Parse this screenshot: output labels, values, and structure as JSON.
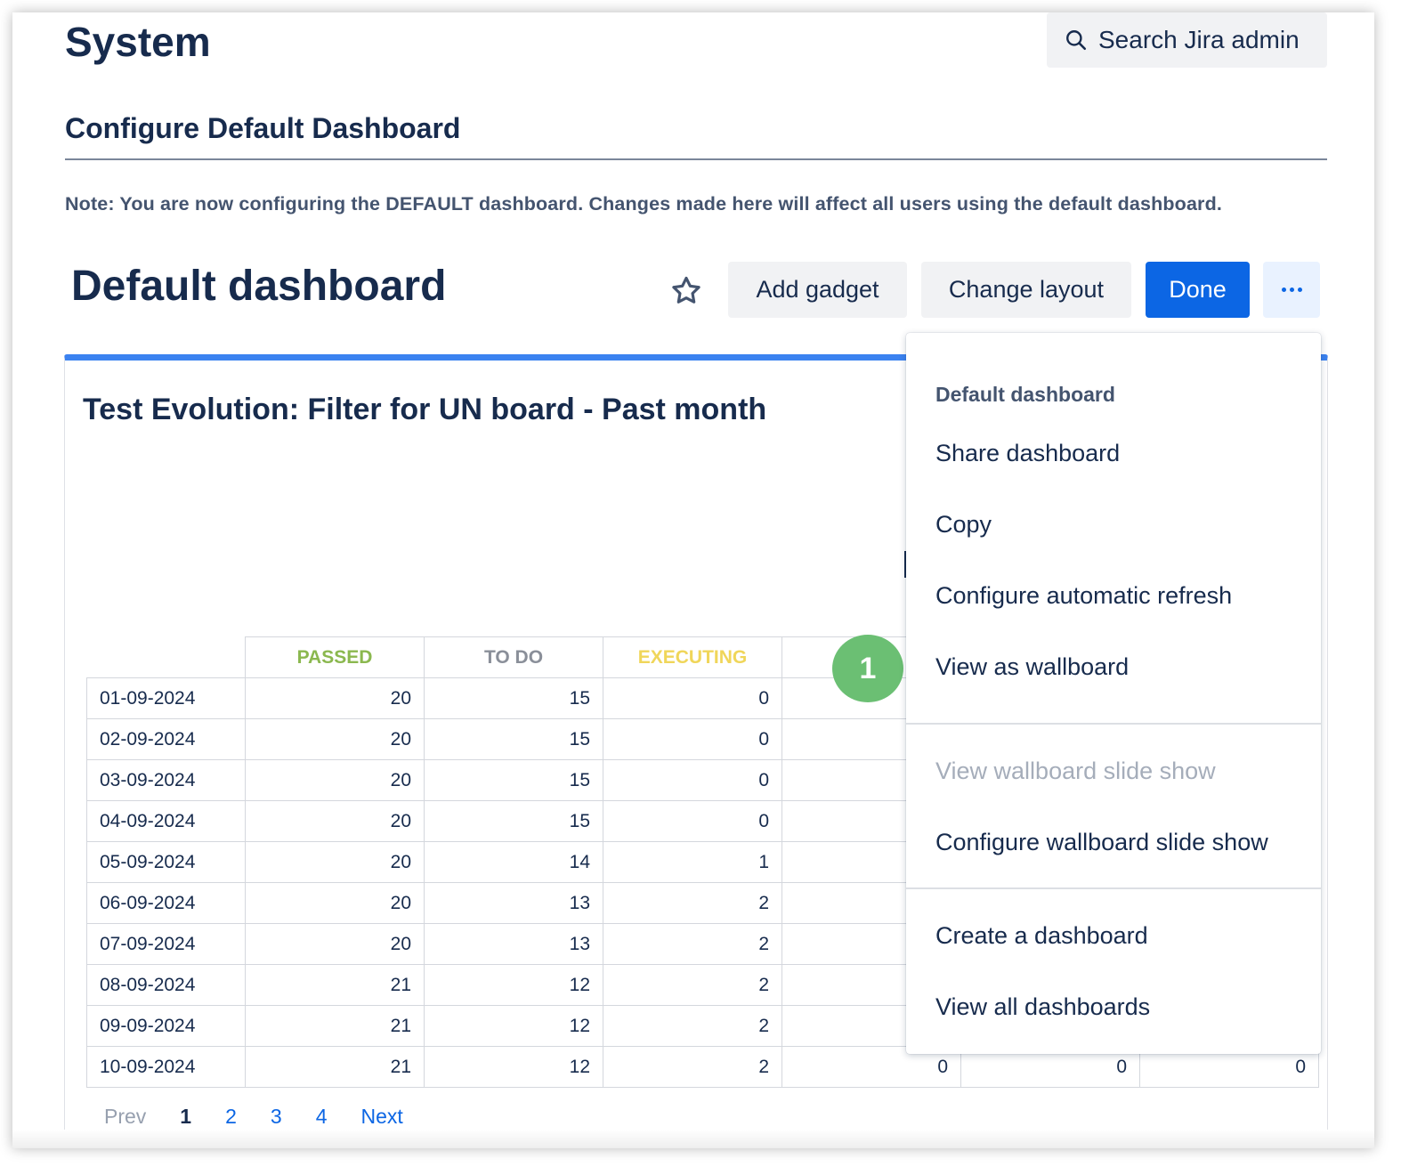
{
  "header": {
    "system_title": "System",
    "search_label": "Search Jira admin"
  },
  "config": {
    "title": "Configure Default Dashboard",
    "note": "Note: You are now configuring the DEFAULT dashboard. Changes made here will affect all users using the default dashboard."
  },
  "dashboard": {
    "title": "Default dashboard",
    "star_icon": "star-icon",
    "add_gadget": "Add gadget",
    "change_layout": "Change layout",
    "done": "Done",
    "more_icon": "more-icon"
  },
  "gadget": {
    "title": "Test Evolution: Filter for UN board - Past month",
    "columns": [
      {
        "label": "PASSED",
        "color": "#8bb84f"
      },
      {
        "label": "TO DO",
        "color": "#8a8f99"
      },
      {
        "label": "EXECUTING",
        "color": "#f0d65a"
      }
    ],
    "rows": [
      {
        "date": "01-09-2024",
        "passed": "20",
        "todo": "15",
        "executing": "0"
      },
      {
        "date": "02-09-2024",
        "passed": "20",
        "todo": "15",
        "executing": "0"
      },
      {
        "date": "03-09-2024",
        "passed": "20",
        "todo": "15",
        "executing": "0"
      },
      {
        "date": "04-09-2024",
        "passed": "20",
        "todo": "15",
        "executing": "0"
      },
      {
        "date": "05-09-2024",
        "passed": "20",
        "todo": "14",
        "executing": "1"
      },
      {
        "date": "06-09-2024",
        "passed": "20",
        "todo": "13",
        "executing": "2"
      },
      {
        "date": "07-09-2024",
        "passed": "20",
        "todo": "13",
        "executing": "2"
      },
      {
        "date": "08-09-2024",
        "passed": "21",
        "todo": "12",
        "executing": "2"
      },
      {
        "date": "09-09-2024",
        "passed": "21",
        "todo": "12",
        "executing": "2"
      },
      {
        "date": "10-09-2024",
        "passed": "21",
        "todo": "12",
        "executing": "2",
        "extra": [
          "0",
          "0",
          "0"
        ]
      }
    ],
    "pager": {
      "prev": "Prev",
      "current": "1",
      "pages": [
        "2",
        "3",
        "4"
      ],
      "next": "Next"
    }
  },
  "callout": {
    "number": "1",
    "color": "#6bbf73"
  },
  "menu": {
    "heading": "Default dashboard",
    "items": [
      {
        "label": "Share dashboard",
        "disabled": false
      },
      {
        "label": "Copy",
        "disabled": false
      },
      {
        "label": "Configure automatic refresh",
        "disabled": false
      },
      {
        "label": "View as wallboard",
        "disabled": false
      },
      {
        "label": "View wallboard slide show",
        "disabled": true
      },
      {
        "label": "Configure wallboard slide show",
        "disabled": false
      },
      {
        "label": "Create a dashboard",
        "disabled": false
      },
      {
        "label": "View all dashboards",
        "disabled": false
      }
    ]
  },
  "colors": {
    "primary": "#0c66e4",
    "gadget_accent": "#3b82f0",
    "text": "#172b4d"
  }
}
